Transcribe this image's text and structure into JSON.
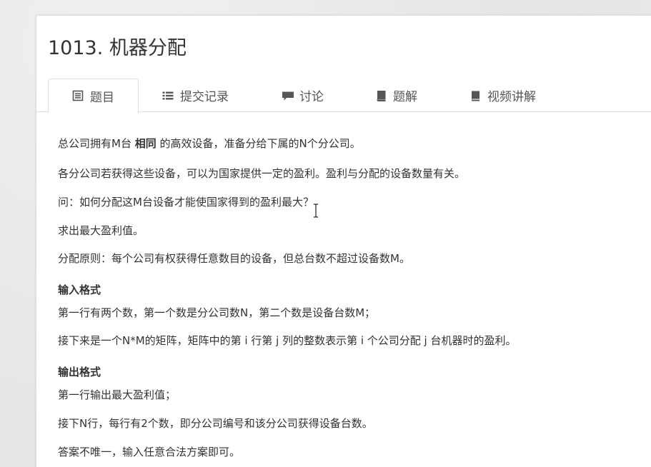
{
  "problem": {
    "title": "1013. 机器分配"
  },
  "tabs": [
    {
      "label": "题目",
      "icon": "list-box-icon",
      "active": true
    },
    {
      "label": "提交记录",
      "icon": "list-icon",
      "active": false
    },
    {
      "label": "讨论",
      "icon": "comment-icon",
      "active": false
    },
    {
      "label": "题解",
      "icon": "book-icon",
      "active": false
    },
    {
      "label": "视频讲解",
      "icon": "book-icon",
      "active": false
    }
  ],
  "description": {
    "line1_pre": "总公司拥有M台 ",
    "line1_bold": "相同",
    "line1_post": " 的高效设备，准备分给下属的N个分公司。",
    "line2": "各分公司若获得这些设备，可以为国家提供一定的盈利。盈利与分配的设备数量有关。",
    "line3": "问：如何分配这M台设备才能使国家得到的盈利最大？",
    "line4": "求出最大盈利值。",
    "line5": "分配原则：每个公司有权获得任意数目的设备，但总台数不超过设备数M。"
  },
  "input_format": {
    "heading": "输入格式",
    "line1": "第一行有两个数，第一个数是分公司数N，第二个数是设备台数M；",
    "line2": "接下来是一个N*M的矩阵，矩阵中的第 i 行第 j 列的整数表示第 i 个公司分配 j 台机器时的盈利。"
  },
  "output_format": {
    "heading": "输出格式",
    "line1": "第一行输出最大盈利值；",
    "line2": "接下N行，每行有2个数，即分公司编号和该分公司获得设备台数。",
    "line3": "答案不唯一，输入任意合法方案即可。"
  },
  "colors": {
    "text": "#333333",
    "tab_text": "#555555",
    "border": "#dddddd",
    "icon": "#555555"
  }
}
